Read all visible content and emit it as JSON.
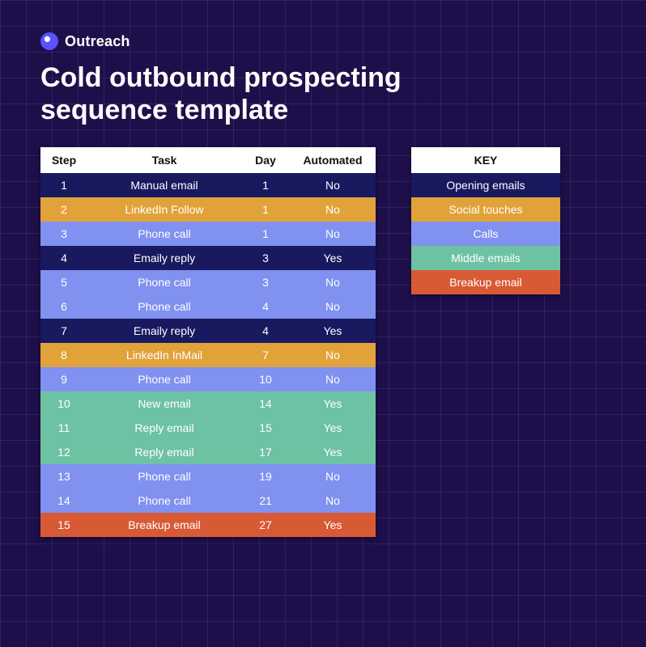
{
  "brand": {
    "name": "Outreach"
  },
  "title": "Cold outbound prospecting sequence template",
  "tableHeaders": {
    "step": "Step",
    "task": "Task",
    "day": "Day",
    "automated": "Automated"
  },
  "rows": [
    {
      "step": "1",
      "task": "Manual email",
      "day": "1",
      "automated": "No",
      "kind": "opening"
    },
    {
      "step": "2",
      "task": "LinkedIn Follow",
      "day": "1",
      "automated": "No",
      "kind": "social"
    },
    {
      "step": "3",
      "task": "Phone call",
      "day": "1",
      "automated": "No",
      "kind": "call"
    },
    {
      "step": "4",
      "task": "Emaily reply",
      "day": "3",
      "automated": "Yes",
      "kind": "opening"
    },
    {
      "step": "5",
      "task": "Phone call",
      "day": "3",
      "automated": "No",
      "kind": "call"
    },
    {
      "step": "6",
      "task": "Phone call",
      "day": "4",
      "automated": "No",
      "kind": "call"
    },
    {
      "step": "7",
      "task": "Emaily reply",
      "day": "4",
      "automated": "Yes",
      "kind": "opening"
    },
    {
      "step": "8",
      "task": "LinkedIn InMail",
      "day": "7",
      "automated": "No",
      "kind": "social"
    },
    {
      "step": "9",
      "task": "Phone call",
      "day": "10",
      "automated": "No",
      "kind": "call"
    },
    {
      "step": "10",
      "task": "New email",
      "day": "14",
      "automated": "Yes",
      "kind": "middle"
    },
    {
      "step": "11",
      "task": "Reply email",
      "day": "15",
      "automated": "Yes",
      "kind": "middle"
    },
    {
      "step": "12",
      "task": "Reply email",
      "day": "17",
      "automated": "Yes",
      "kind": "middle"
    },
    {
      "step": "13",
      "task": "Phone call",
      "day": "19",
      "automated": "No",
      "kind": "call"
    },
    {
      "step": "14",
      "task": "Phone call",
      "day": "21",
      "automated": "No",
      "kind": "call"
    },
    {
      "step": "15",
      "task": "Breakup email",
      "day": "27",
      "automated": "Yes",
      "kind": "breakup"
    }
  ],
  "key": {
    "header": "KEY",
    "items": [
      {
        "label": "Opening emails",
        "kind": "opening"
      },
      {
        "label": "Social touches",
        "kind": "social"
      },
      {
        "label": "Calls",
        "kind": "call"
      },
      {
        "label": "Middle emails",
        "kind": "middle"
      },
      {
        "label": "Breakup email",
        "kind": "breakup"
      }
    ]
  }
}
